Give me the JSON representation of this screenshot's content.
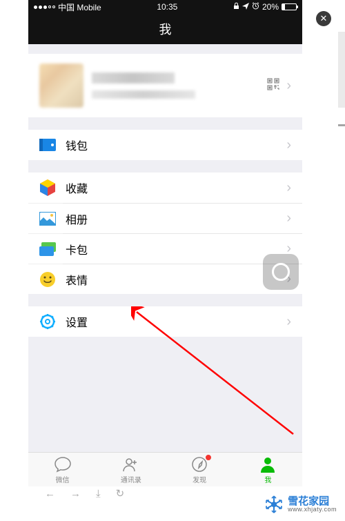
{
  "status": {
    "carrier": "中国 Mobile",
    "time": "10:35",
    "battery_pct": "20%"
  },
  "header": {
    "title": "我"
  },
  "menu": {
    "wallet": "钱包",
    "favorites": "收藏",
    "album": "相册",
    "cards": "卡包",
    "stickers": "表情",
    "settings": "设置"
  },
  "tabs": {
    "chat": "微信",
    "contacts": "通讯录",
    "discover": "发现",
    "me": "我"
  },
  "watermark": {
    "brand": "雪花家园",
    "url": "www.xhjaty.com"
  },
  "colors": {
    "accent": "#09bb07",
    "wallet": "#1986e5",
    "favorites_red": "#e64340",
    "settings": "#10aeff",
    "wm_blue": "#2b7fd6"
  }
}
